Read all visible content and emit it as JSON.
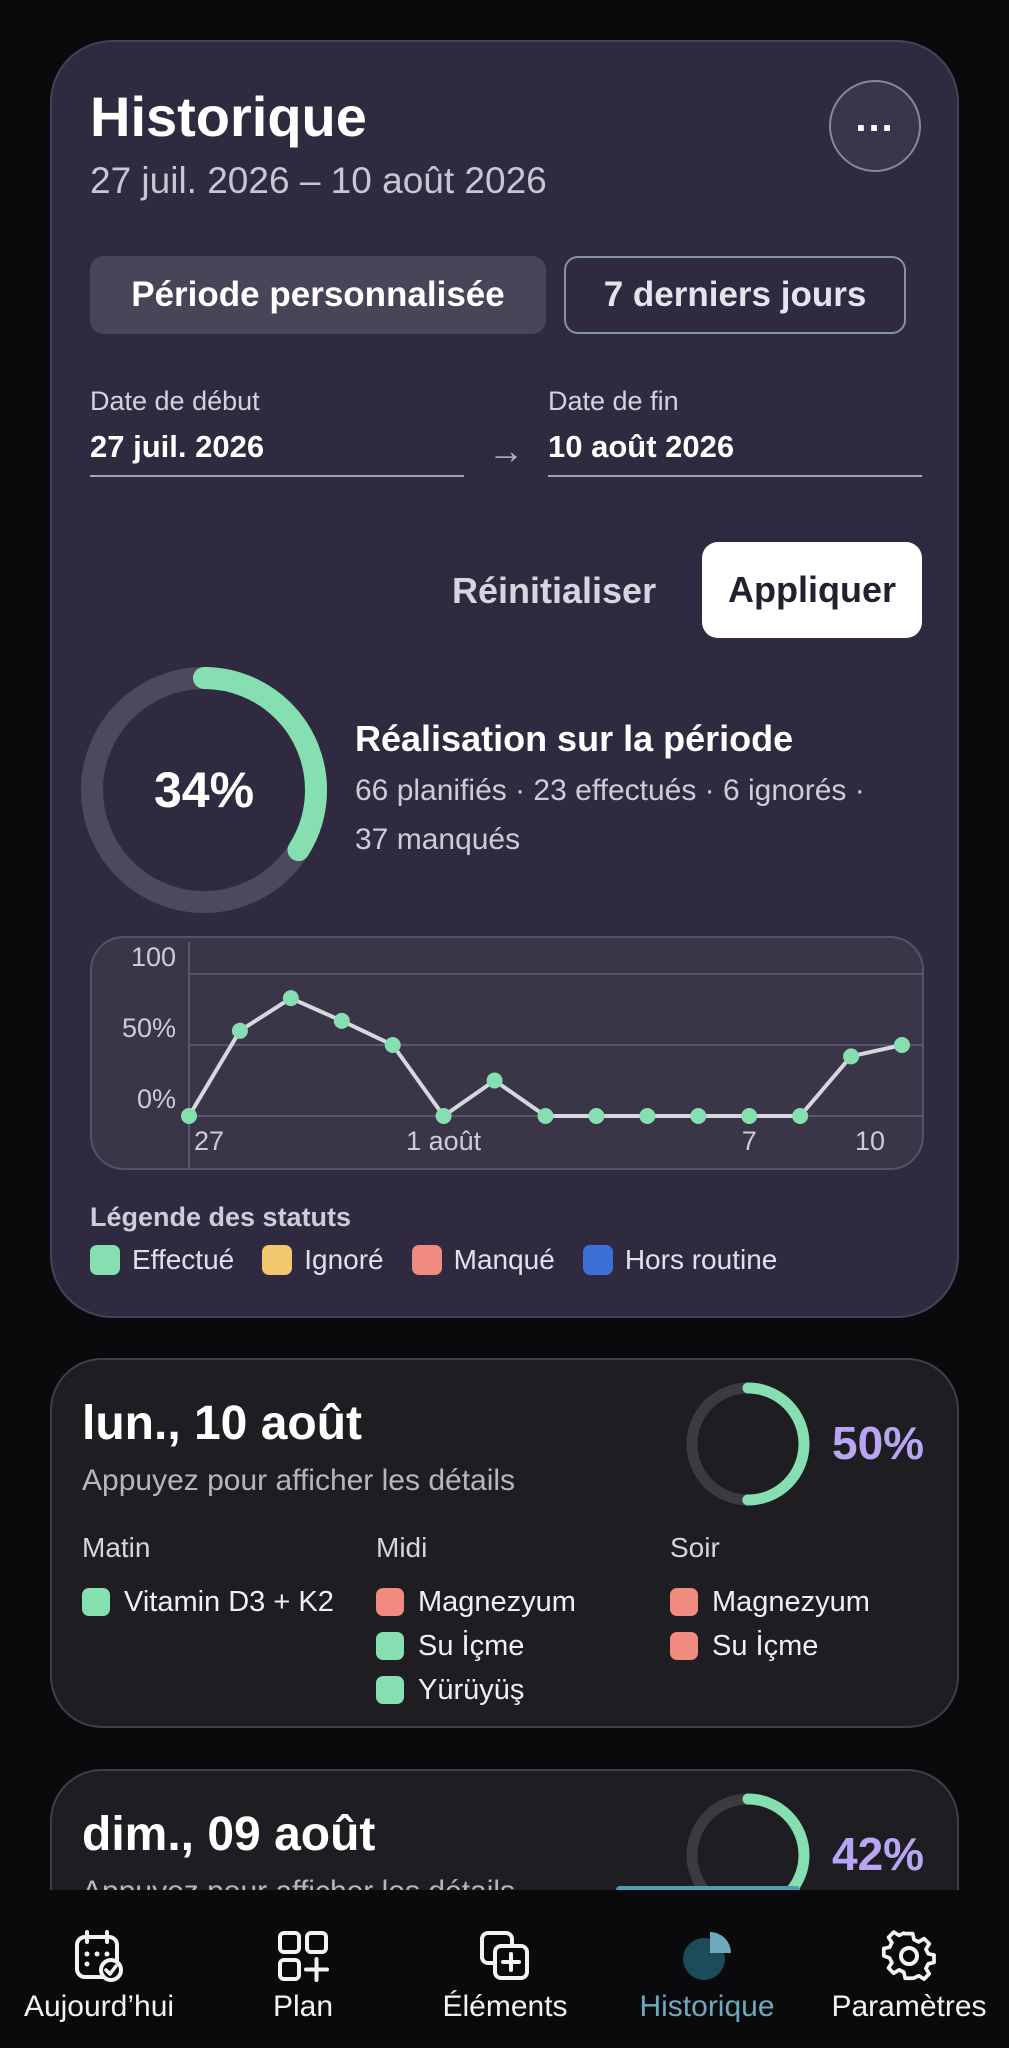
{
  "header": {
    "title": "Historique",
    "date_range": "27 juil. 2026 – 10 août 2026",
    "more_label": "..."
  },
  "period": {
    "custom_label": "Période personnalisée",
    "last7_label": "7 derniers jours"
  },
  "fields": {
    "start_label": "Date de début",
    "start_value": "27 juil. 2026",
    "end_label": "Date de fin",
    "end_value": "10 août 2026",
    "arrow": "→"
  },
  "actions": {
    "reset_label": "Réinitialiser",
    "apply_label": "Appliquer"
  },
  "summary": {
    "percent": "34%",
    "percent_value": 0.34,
    "title": "Réalisation sur la période",
    "stats_line1": "66 planifiés · 23 effectués · 6 ignorés ·",
    "stats_line2": "37 manqués"
  },
  "chart_data": {
    "type": "line",
    "x_ticks": [
      "27",
      "1 août",
      "7",
      "10"
    ],
    "y_ticks": [
      "100",
      "50%",
      "0%"
    ],
    "ylim": [
      0,
      100
    ],
    "series": [
      {
        "values": [
          0,
          60,
          83,
          67,
          50,
          0,
          25,
          0,
          0,
          0,
          0,
          0,
          0,
          42,
          50
        ]
      }
    ],
    "colors": {
      "line": "#d8d6de",
      "point": "#86dfb0"
    },
    "grid": true
  },
  "legend": {
    "title": "Légende des statuts",
    "items": [
      {
        "label": "Effectué",
        "color": "#86dfb0"
      },
      {
        "label": "Ignoré",
        "color": "#f2c86e"
      },
      {
        "label": "Manqué",
        "color": "#f28b7f"
      },
      {
        "label": "Hors routine",
        "color": "#3b6fd6"
      }
    ]
  },
  "days": [
    {
      "title": "lun., 10 août",
      "subtitle": "Appuyez pour afficher les détails",
      "percent": "50%",
      "percent_value": 0.5,
      "columns": [
        {
          "label": "Matin",
          "items": [
            {
              "name": "Vitamin D3 + K2",
              "status": "done"
            }
          ]
        },
        {
          "label": "Midi",
          "items": [
            {
              "name": "Magnezyum",
              "status": "missed"
            },
            {
              "name": "Su İçme",
              "status": "done"
            },
            {
              "name": "Yürüyüş",
              "status": "done"
            }
          ]
        },
        {
          "label": "Soir",
          "items": [
            {
              "name": "Magnezyum",
              "status": "missed"
            },
            {
              "name": "Su İçme",
              "status": "missed"
            }
          ]
        }
      ]
    },
    {
      "title": "dim., 09 août",
      "subtitle": "Appuyez pour afficher les détails",
      "percent": "42%",
      "percent_value": 0.42
    }
  ],
  "status_colors": {
    "done": "#86dfb0",
    "missed": "#f28b7f",
    "ignored": "#f2c86e",
    "off": "#3b6fd6"
  },
  "nav": {
    "items": [
      {
        "label": "Aujourd’hui",
        "icon": "calendar-check-icon"
      },
      {
        "label": "Plan",
        "icon": "grid-plus-icon"
      },
      {
        "label": "Éléments",
        "icon": "add-copy-icon"
      },
      {
        "label": "Historique",
        "icon": "pie-chart-icon",
        "active": true
      },
      {
        "label": "Paramètres",
        "icon": "gear-icon"
      }
    ]
  }
}
